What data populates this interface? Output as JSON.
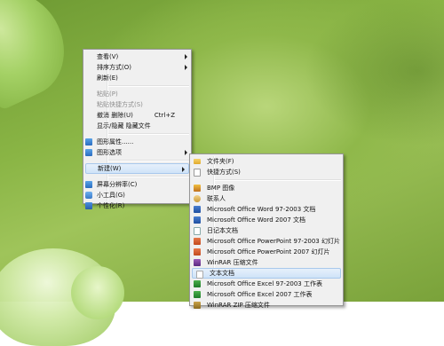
{
  "context_menu": {
    "items": [
      {
        "label": "查看(V)",
        "submenu": true
      },
      {
        "label": "排序方式(O)",
        "submenu": true
      },
      {
        "label": "刷新(E)"
      },
      {
        "label": "粘贴(P)",
        "disabled": true
      },
      {
        "label": "粘贴快捷方式(S)",
        "disabled": true
      },
      {
        "label": "撤消 删除(U)",
        "shortcut": "Ctrl+Z"
      },
      {
        "label": "显示/隐藏 隐藏文件"
      },
      {
        "label": "图形属性......",
        "icon": "display-icon"
      },
      {
        "label": "图形选项",
        "icon": "display-icon",
        "submenu": true
      },
      {
        "label": "新建(W)",
        "submenu": true,
        "highlighted": true
      },
      {
        "label": "屏幕分辨率(C)",
        "icon": "display-icon"
      },
      {
        "label": "小工具(G)",
        "icon": "gadget-icon"
      },
      {
        "label": "个性化(R)",
        "icon": "personalize-icon"
      }
    ]
  },
  "new_submenu": {
    "items": [
      {
        "label": "文件夹(F)",
        "icon": "folder-icon"
      },
      {
        "label": "快捷方式(S)",
        "icon": "shortcut-icon"
      },
      {
        "label": "BMP 图像",
        "icon": "bitmap-icon"
      },
      {
        "label": "联系人",
        "icon": "contact-icon"
      },
      {
        "label": "Microsoft Office Word 97-2003 文档",
        "icon": "word-icon"
      },
      {
        "label": "Microsoft Office Word 2007 文档",
        "icon": "word-icon"
      },
      {
        "label": "日记本文档",
        "icon": "journal-icon"
      },
      {
        "label": "Microsoft Office PowerPoint 97-2003 幻灯片",
        "icon": "powerpoint-icon"
      },
      {
        "label": "Microsoft Office PowerPoint 2007 幻灯片",
        "icon": "powerpoint-icon"
      },
      {
        "label": "WinRAR 压缩文件",
        "icon": "winrar-icon"
      },
      {
        "label": "文本文档",
        "icon": "text-document-icon",
        "highlighted": true
      },
      {
        "label": "Microsoft Office Excel 97-2003 工作表",
        "icon": "excel-icon"
      },
      {
        "label": "Microsoft Office Excel 2007 工作表",
        "icon": "excel-icon"
      },
      {
        "label": "WinRAR ZIP 压缩文件",
        "icon": "winrar-zip-icon"
      }
    ]
  }
}
